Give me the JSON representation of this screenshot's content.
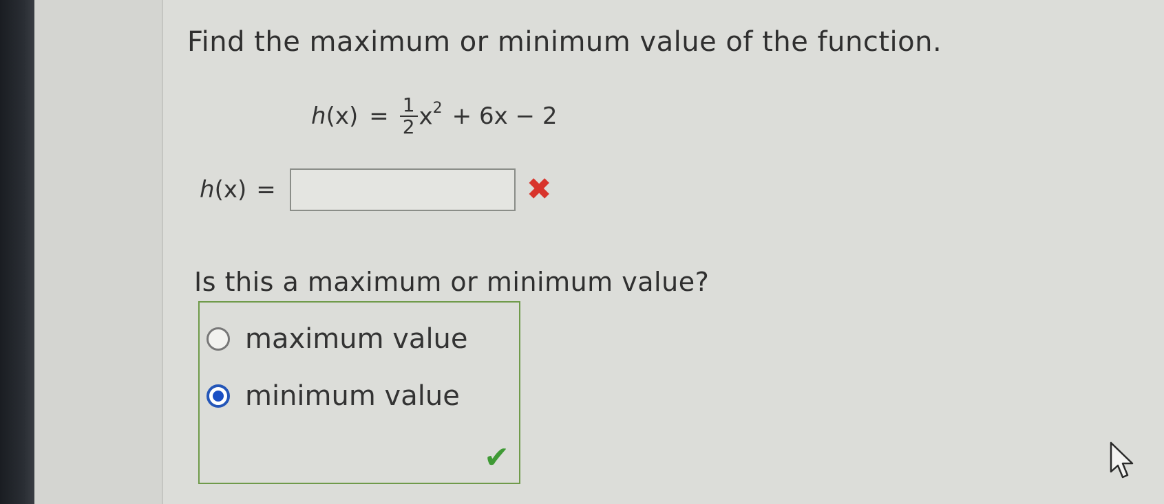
{
  "question": {
    "prompt": "Find the maximum or minimum value of the function."
  },
  "equation": {
    "lhs_func": "h",
    "lhs_arg": "(x)",
    "equals": "=",
    "frac_num": "1",
    "frac_den": "2",
    "x_var": "x",
    "x_exp": "2",
    "rest": "+ 6x − 2"
  },
  "answer": {
    "lhs_func": "h",
    "lhs_arg": "(x)",
    "equals": "=",
    "value": "",
    "status_icon": "wrong-x-icon",
    "status_color": "#d8342c"
  },
  "question2": {
    "prompt": "Is this a maximum or minimum value?"
  },
  "choices": [
    {
      "label": "maximum value",
      "selected": false
    },
    {
      "label": "minimum value",
      "selected": true
    }
  ],
  "choice_status": {
    "icon": "checkmark-icon",
    "color": "#3f9a35"
  },
  "colors": {
    "selected_radio": "#1a4fc4",
    "choice_border": "#6f9a4a"
  }
}
